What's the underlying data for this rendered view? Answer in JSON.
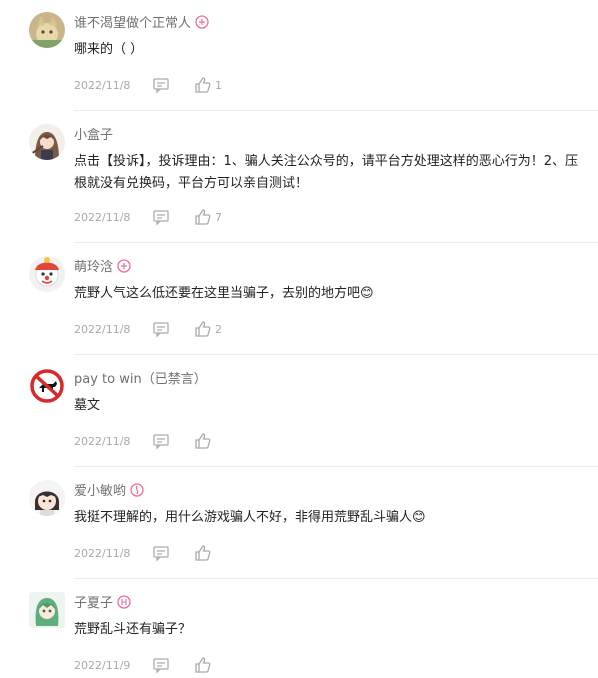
{
  "comments": [
    {
      "user": "谁不渴望做个正常人",
      "text": "哪来的（ ）",
      "date": "2022/11/8",
      "likes": "1",
      "badge_icon": "level-badge-icon",
      "avatar_icon": "cat-avatar"
    },
    {
      "user": "小盒子",
      "text": "点击【投诉】，投诉理由：1、骗人关注公众号的，请平台方处理这样的恶心行为！2、压根就没有兑换码，平台方可以亲自测试！",
      "date": "2022/11/8",
      "likes": "7",
      "badge_icon": "",
      "avatar_icon": "anime-girl-avatar"
    },
    {
      "user": "萌玲浛",
      "text": "荒野人气这么低还要在这里当骗子，去别的地方吧😊",
      "date": "2022/11/8",
      "likes": "2",
      "badge_icon": "level-badge-icon",
      "avatar_icon": "clown-avatar"
    },
    {
      "user": "pay to win（已禁言）",
      "text": "墓文",
      "date": "2022/11/8",
      "likes": "",
      "badge_icon": "",
      "avatar_icon": "no-dog-sign-avatar"
    },
    {
      "user": "爱小敏哟",
      "text": "我挺不理解的，用什么游戏骗人不好，非得用荒野乱斗骗人😊",
      "date": "2022/11/8",
      "likes": "",
      "badge_icon": "level-badge-icon",
      "avatar_icon": "chibi-avatar"
    },
    {
      "user": "子夏子",
      "text": "荒野乱斗还有骗子？",
      "date": "2022/11/9",
      "likes": "",
      "badge_icon": "level-badge-icon",
      "avatar_icon": "green-hair-avatar"
    }
  ],
  "colors": {
    "name": "#707070",
    "text": "#222222",
    "meta": "#a9a9a9",
    "badge": "#f06b9c"
  }
}
